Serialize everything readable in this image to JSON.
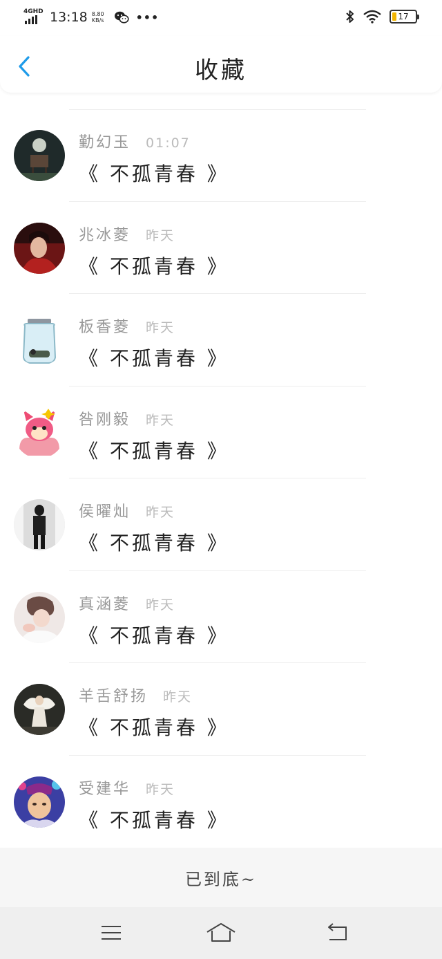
{
  "status_bar": {
    "network": "4GHD",
    "time": "13:18",
    "speed_value": "8.80",
    "speed_unit": "KB/s",
    "more": "•••",
    "battery_level": "17"
  },
  "header": {
    "title": "收藏",
    "back_icon": "chevron-left-icon",
    "accent_color": "#1e9be9"
  },
  "items": [
    {
      "name": "勤幻玉",
      "time": "01:07",
      "book": "《 不孤青春 》"
    },
    {
      "name": "兆冰菱",
      "time": "昨天",
      "book": "《 不孤青春 》"
    },
    {
      "name": "板香菱",
      "time": "昨天",
      "book": "《 不孤青春 》"
    },
    {
      "name": "咎刚毅",
      "time": "昨天",
      "book": "《 不孤青春 》"
    },
    {
      "name": "侯曜灿",
      "time": "昨天",
      "book": "《 不孤青春 》"
    },
    {
      "name": "真涵菱",
      "time": "昨天",
      "book": "《 不孤青春 》"
    },
    {
      "name": "羊舌舒扬",
      "time": "昨天",
      "book": "《 不孤青春 》"
    },
    {
      "name": "受建华",
      "time": "昨天",
      "book": "《 不孤青春 》"
    }
  ],
  "footer": {
    "end_text": "已到底~"
  },
  "nav_bar": {
    "menu_icon": "menu-icon",
    "home_icon": "home-icon",
    "back_icon": "back-icon"
  }
}
